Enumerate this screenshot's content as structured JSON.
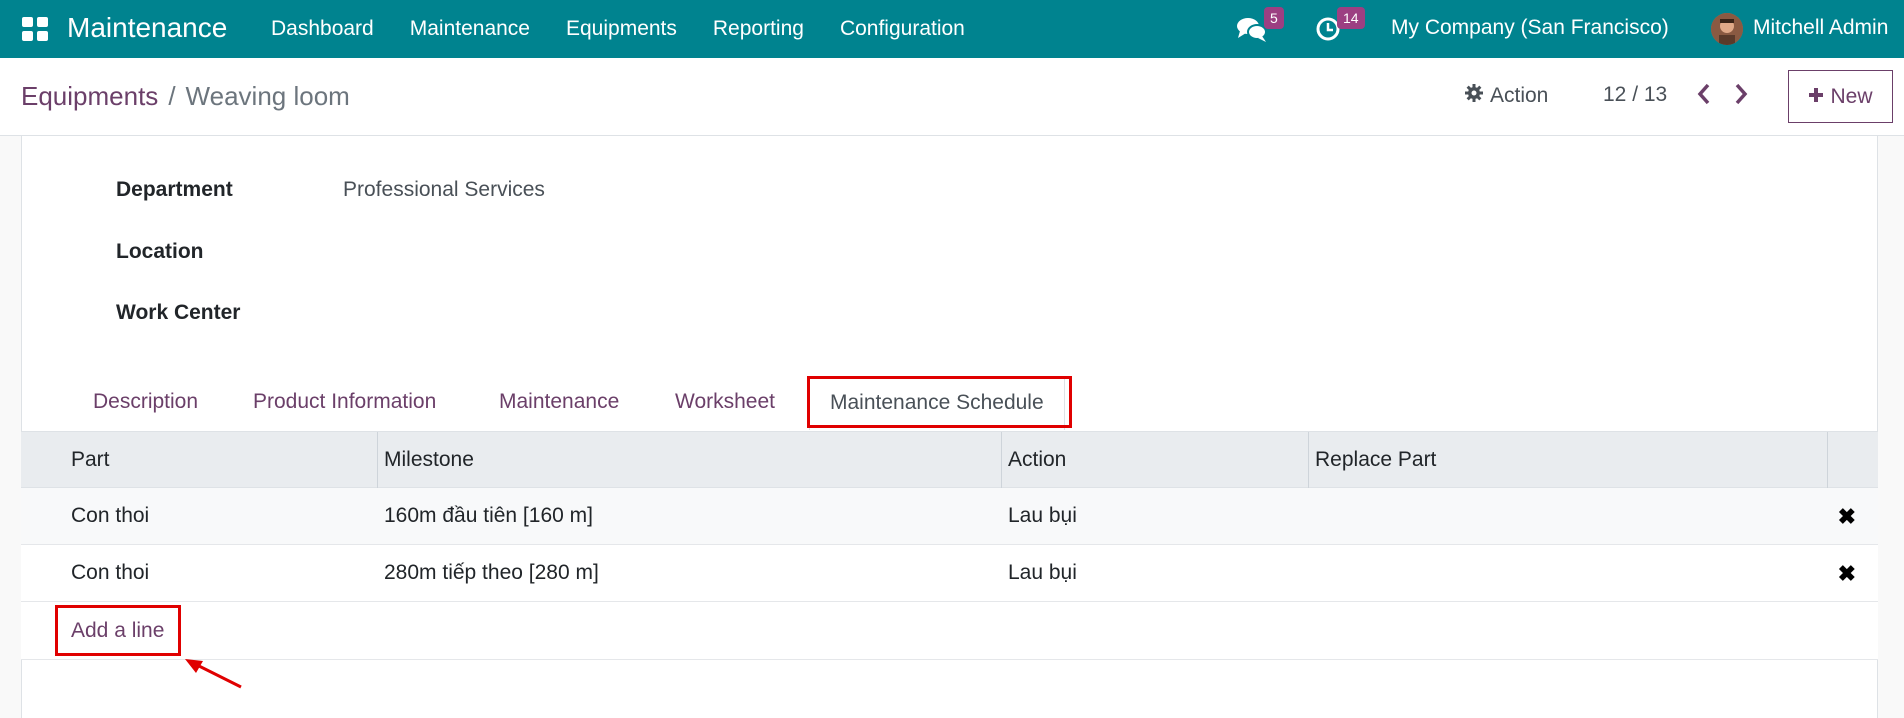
{
  "navbar": {
    "app_title": "Maintenance",
    "menu": [
      "Dashboard",
      "Maintenance",
      "Equipments",
      "Reporting",
      "Configuration"
    ],
    "messages_badge": "5",
    "activities_badge": "14",
    "company": "My Company (San Francisco)",
    "user": "Mitchell Admin"
  },
  "control": {
    "breadcrumb_parent": "Equipments",
    "breadcrumb_sep": "/",
    "breadcrumb_current": "Weaving loom",
    "action_label": "Action",
    "pager": "12 / 13",
    "new_label": "New"
  },
  "form": {
    "fields": [
      {
        "label": "Department",
        "value": "Professional Services"
      },
      {
        "label": "Location",
        "value": ""
      },
      {
        "label": "Work Center",
        "value": ""
      }
    ]
  },
  "tabs": [
    "Description",
    "Product Information",
    "Maintenance",
    "Worksheet",
    "Maintenance Schedule"
  ],
  "active_tab": "Maintenance Schedule",
  "table": {
    "columns": [
      "Part",
      "Milestone",
      "Action",
      "Replace Part"
    ],
    "rows": [
      {
        "part": "Con thoi",
        "milestone": "160m đầu tiên [160 m]",
        "action": "Lau bụi",
        "replace_part": ""
      },
      {
        "part": "Con thoi",
        "milestone": "280m tiếp theo [280 m]",
        "action": "Lau bụi",
        "replace_part": ""
      }
    ],
    "add_line": "Add a line"
  },
  "colors": {
    "navbar": "#00838f",
    "brand_purple": "#6b3f69",
    "badge": "#9c3f82",
    "highlight": "#e00000"
  }
}
